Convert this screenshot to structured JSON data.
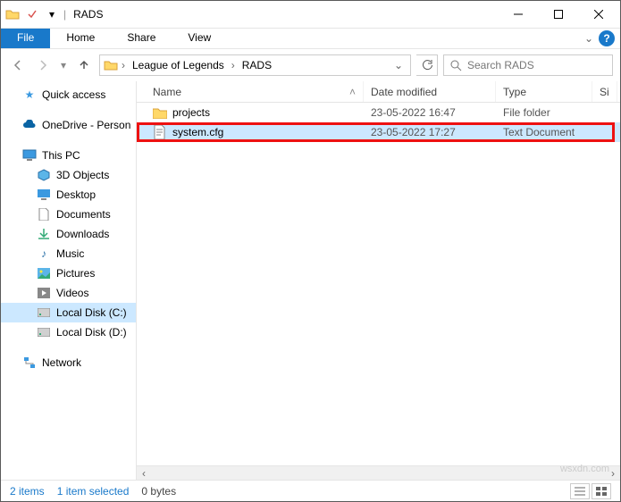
{
  "title": "RADS",
  "ribbon": {
    "file": "File",
    "tabs": [
      "Home",
      "Share",
      "View"
    ]
  },
  "breadcrumbs": [
    "League of Legends",
    "RADS"
  ],
  "search_placeholder": "Search RADS",
  "columns": {
    "name": "Name",
    "date": "Date modified",
    "type": "Type",
    "size": "Si"
  },
  "rows": [
    {
      "icon": "folder",
      "name": "projects",
      "date": "23-05-2022 16:47",
      "type": "File folder",
      "selected": false
    },
    {
      "icon": "file",
      "name": "system.cfg",
      "date": "23-05-2022 17:27",
      "type": "Text Document",
      "selected": true
    }
  ],
  "nav": {
    "quick": "Quick access",
    "onedrive": "OneDrive - Person",
    "thispc": "This PC",
    "items": [
      "3D Objects",
      "Desktop",
      "Documents",
      "Downloads",
      "Music",
      "Pictures",
      "Videos",
      "Local Disk (C:)",
      "Local Disk (D:)"
    ],
    "network": "Network"
  },
  "status": {
    "items": "2 items",
    "selected": "1 item selected",
    "size": "0 bytes"
  },
  "watermark": "wsxdn.com"
}
